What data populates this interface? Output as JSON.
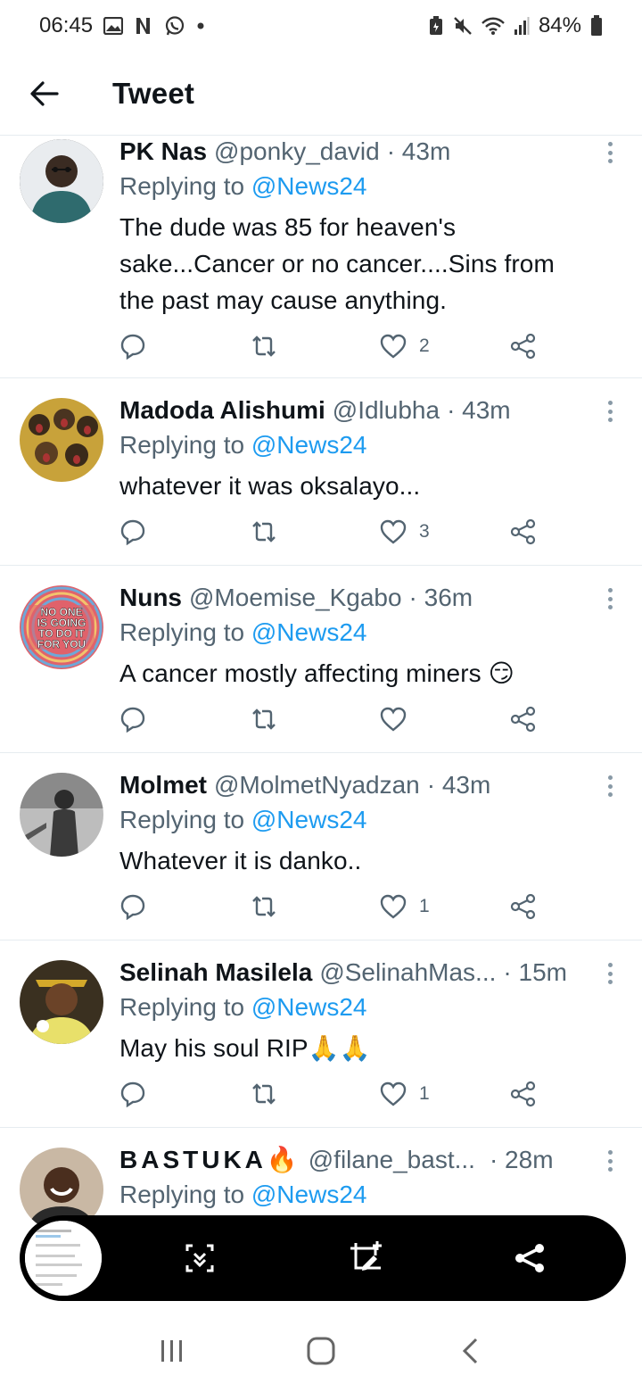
{
  "status_bar": {
    "time": "06:45",
    "battery": "84%"
  },
  "header": {
    "title": "Tweet"
  },
  "replying_prefix": "Replying to",
  "tweets": [
    {
      "name": "PK Nas",
      "handle": "@ponky_david",
      "time": "· 43m",
      "replying_to": "@News24",
      "text": [
        "The dude was 85 for heaven's",
        "sake...Cancer or no cancer....Sins from",
        "the past may cause anything."
      ],
      "likes": "2"
    },
    {
      "name": "Madoda Alishumi",
      "handle": "@Idlubha",
      "time": "· 43m",
      "replying_to": "@News24",
      "text": [
        "whatever it was oksalayo..."
      ],
      "likes": "3"
    },
    {
      "name": "Nuns",
      "handle": "@Moemise_Kgabo",
      "time": "· 36m",
      "replying_to": "@News24",
      "text": [
        "A cancer mostly affecting miners 😏"
      ],
      "likes": "",
      "avatar_text": [
        "NO ONE",
        "IS GOING",
        "TO DO IT",
        "FOR YOU"
      ]
    },
    {
      "name": "Molmet",
      "handle": "@MolmetNyadzan",
      "time": "· 43m",
      "replying_to": "@News24",
      "text": [
        "Whatever it is danko.."
      ],
      "likes": "1"
    },
    {
      "name": "Selinah Masilela",
      "handle": "@SelinahMas...",
      "time": "· 15m",
      "replying_to": "@News24",
      "text": [
        "May his soul RIP🙏🙏"
      ],
      "likes": "1"
    },
    {
      "name": "BASTUKA🔥",
      "handle": "@filane_bast...",
      "time": "· 28m",
      "replying_to": "@News24",
      "text": [],
      "likes": ""
    }
  ],
  "colors": {
    "accent": "#1d9bf0",
    "muted": "#536471",
    "toolbar": "#000000"
  },
  "icons": [
    "gallery-icon",
    "netflix-icon",
    "whatsapp-icon",
    "battery-saver-icon",
    "mute-icon",
    "wifi-icon",
    "signal-icon",
    "battery-icon",
    "back-arrow-icon",
    "reply-icon",
    "retweet-icon",
    "heart-icon",
    "share-icon",
    "more-icon",
    "scroll-capture-icon",
    "edit-icon",
    "share-screenshot-icon",
    "recents-icon",
    "home-icon",
    "nav-back-icon"
  ]
}
